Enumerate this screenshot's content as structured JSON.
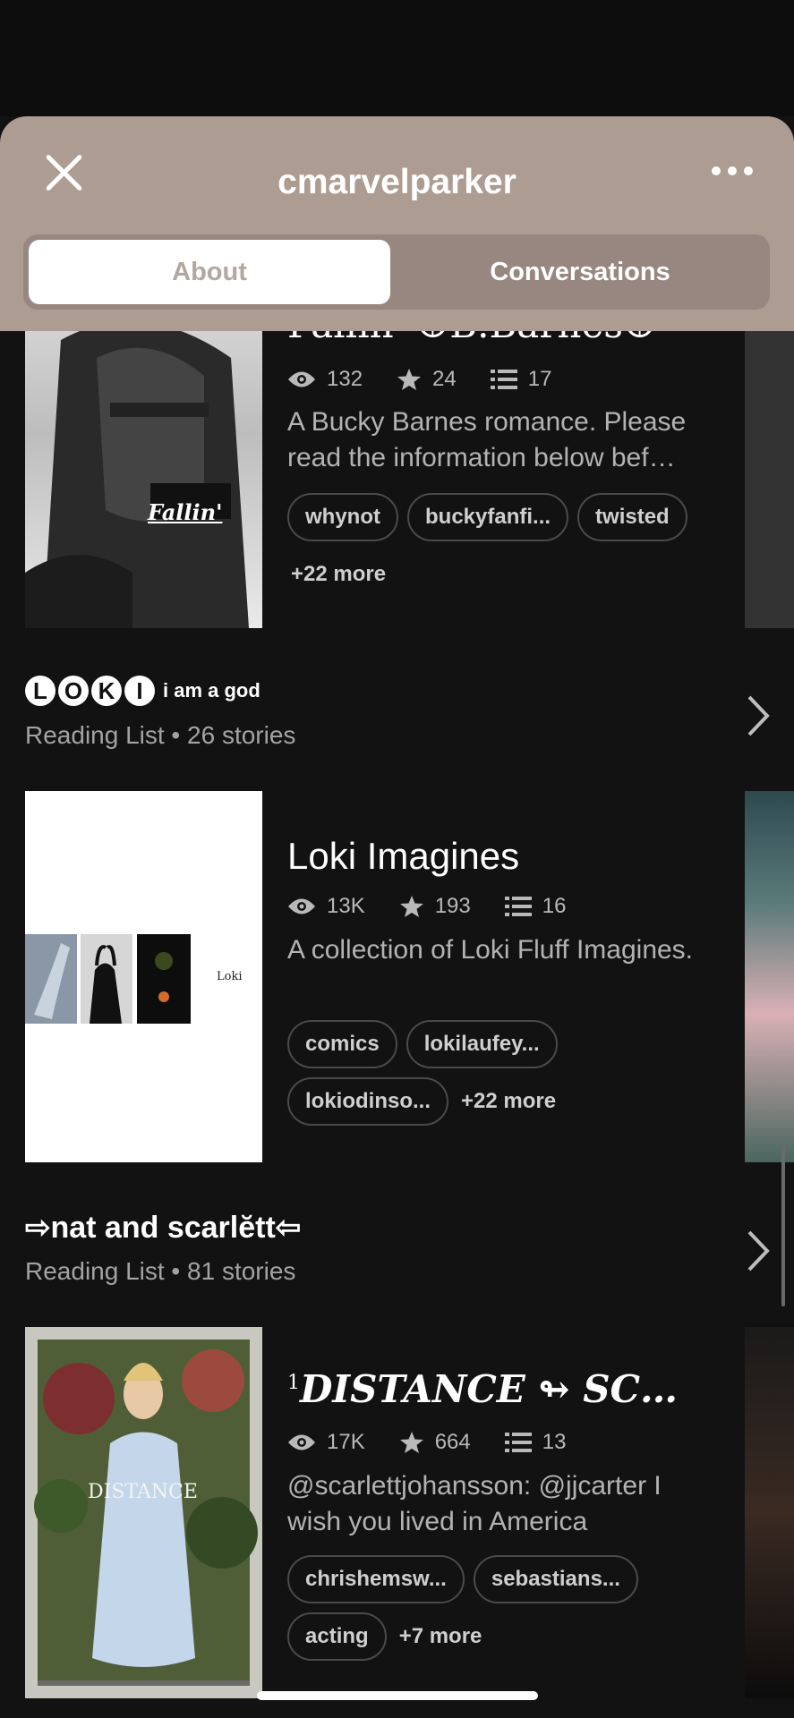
{
  "header": {
    "username": "cmarvelparker",
    "tabs": {
      "about": "About",
      "conversations": "Conversations"
    }
  },
  "stories": [
    {
      "title": "Fallin' ☮B.Barnes☮",
      "cover_text": "Fallin'",
      "views": "132",
      "votes": "24",
      "parts": "17",
      "description": "A Bucky Barnes romance.  Please read the information below bef…",
      "tags": [
        "whynot",
        "buckyfanfi...",
        "twisted"
      ],
      "more": "+22 more"
    },
    {
      "title": "Loki Imagines",
      "cover_text": "Loki",
      "views": "13K",
      "votes": "193",
      "parts": "16",
      "description": "A collection of Loki Fluff Imagines.",
      "tags": [
        "comics",
        "lokilaufey...",
        "lokiodinso..."
      ],
      "more": "+22 more"
    },
    {
      "title_sup": "1",
      "title": "DISTANCE ↬ SC…",
      "cover_text": "DISTANCE",
      "views": "17K",
      "votes": "664",
      "parts": "13",
      "description": "@scarlettjohansson: @jjcarter I wish you lived in America",
      "tags": [
        "chrishemsw...",
        "sebastians...",
        "acting"
      ],
      "more": "+7 more"
    }
  ],
  "lists": [
    {
      "badges": [
        "L",
        "O",
        "K",
        "I"
      ],
      "title": "i am a god",
      "meta": "Reading List • 26 stories"
    },
    {
      "title": "⇨nat and scarlĕtt⇦",
      "meta": "Reading List • 81 stories"
    }
  ],
  "icons": {
    "views": "eye-icon",
    "votes": "star-icon",
    "parts": "list-icon",
    "close": "close-icon",
    "more": "more-dots-icon",
    "chevron": "chevron-right-icon"
  },
  "colors": {
    "header": "#ad9c91",
    "background": "#121212"
  }
}
